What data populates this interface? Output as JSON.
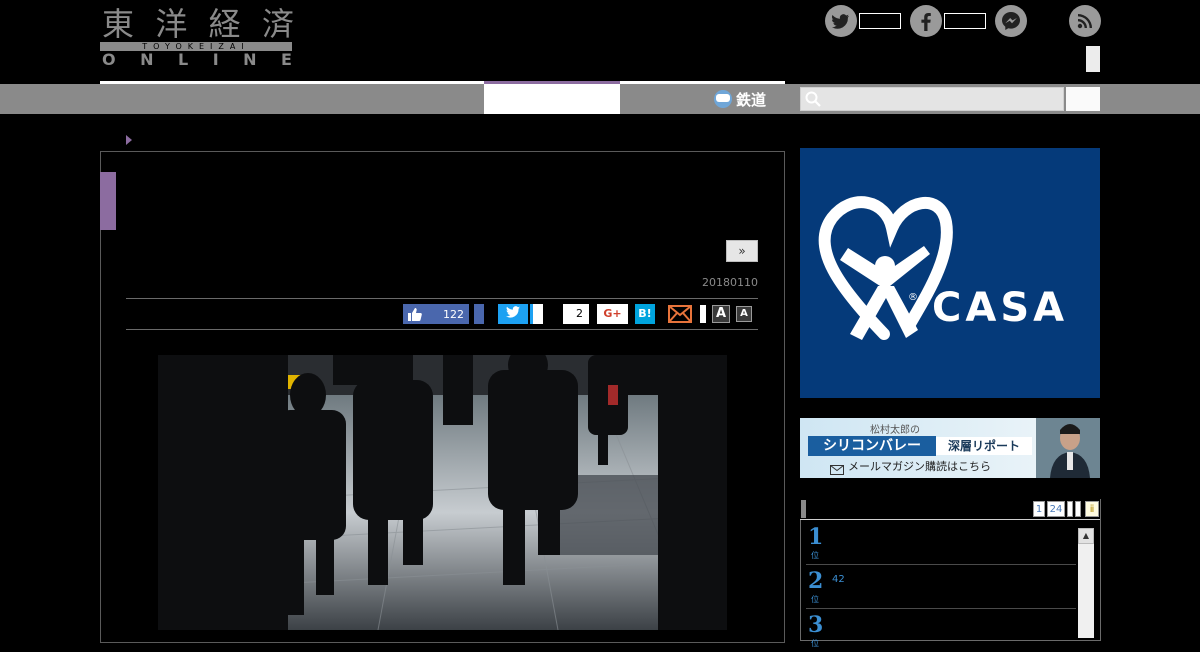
{
  "header": {
    "logo_kanji": [
      "東",
      "洋",
      "経",
      "済"
    ],
    "logo_romaji": "TOYOKEIZAI",
    "logo_online": [
      "O",
      "N",
      "L",
      "I",
      "N",
      "E"
    ],
    "social": [
      {
        "icon": "twitter-icon",
        "glyph": "t"
      },
      {
        "icon": "facebook-icon",
        "glyph": "f"
      },
      {
        "icon": "messenger-icon",
        "glyph": "~"
      },
      {
        "icon": "rss-icon",
        "glyph": "))"
      }
    ]
  },
  "nav": {
    "rail_label": "鉄道",
    "search_placeholder": ""
  },
  "article": {
    "next_label": "»",
    "date": "20180110"
  },
  "share": {
    "like_count": "122",
    "hatena_count": "2",
    "gplus_label": "G+",
    "hatena_label": "B!",
    "font_large": "A",
    "font_small": "A"
  },
  "sidebar": {
    "ad_casa": {
      "brand": "CASA",
      "registered": "®",
      "brand_color": "#053a7a"
    },
    "ad_banner": {
      "line1": "松村太郎の",
      "line2a": "シリコンバレー",
      "line2b": "深層リポート",
      "line3": "メールマガジン購読はこちら"
    },
    "ranking": {
      "pages": [
        "1",
        "24",
        "",
        "",
        "ⅱ"
      ],
      "items": [
        {
          "rank": "1",
          "suffix": "位",
          "value": ""
        },
        {
          "rank": "2",
          "suffix": "位",
          "value": "42"
        },
        {
          "rank": "3",
          "suffix": "位",
          "value": ""
        }
      ]
    }
  }
}
